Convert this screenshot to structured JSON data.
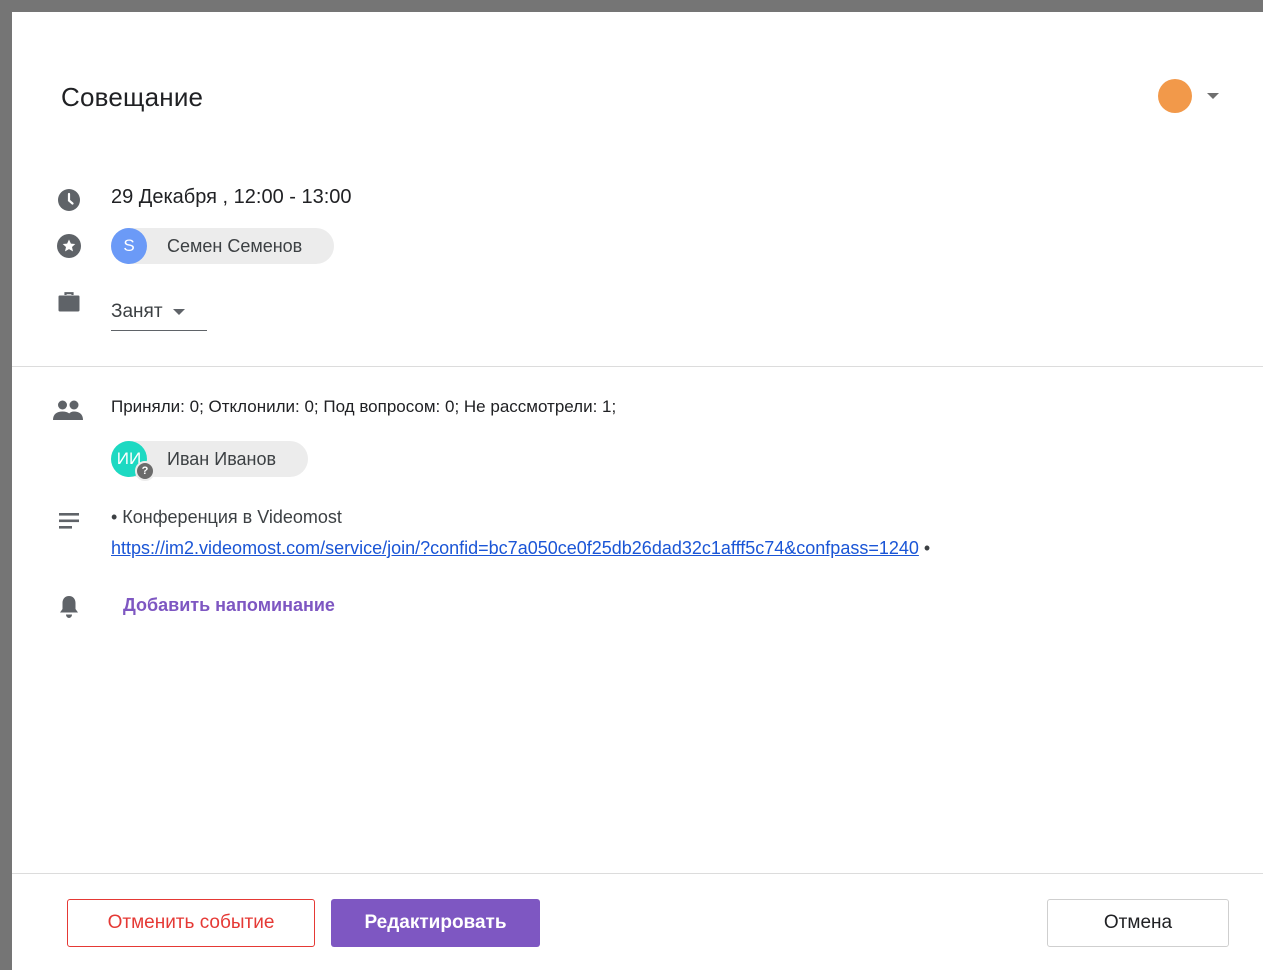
{
  "event": {
    "title": "Совещание",
    "color": "#F2994A",
    "datetime": "29 Декабря , 12:00 - 13:00",
    "organizer": {
      "initial": "S",
      "name": "Семен Семенов",
      "avatar_color": "#6B9AF7"
    },
    "availability": "Занят"
  },
  "attendees": {
    "summary": "Приняли: 0; Отклонили: 0; Под вопросом: 0; Не рассмотрели: 1;",
    "list": [
      {
        "initials": "ИИ",
        "name": "Иван Иванов",
        "avatar_color": "#1DD9C2",
        "status_badge": "?"
      }
    ]
  },
  "description": {
    "line1": "• Конференция в Videomost",
    "link": "https://im2.videomost.com/service/join/?confid=bc7a050ce0f25db26dad32c1afff5c74&confpass=1240",
    "trail": " •"
  },
  "reminder": {
    "add_label": "Добавить напоминание"
  },
  "buttons": {
    "cancel_event": "Отменить событие",
    "edit": "Редактировать",
    "close": "Отмена"
  },
  "icons": {
    "time": "clock-icon",
    "organizer": "star-circle-icon",
    "availability": "briefcase-icon",
    "attendees": "people-icon",
    "description": "notes-icon",
    "reminder": "bell-icon"
  }
}
